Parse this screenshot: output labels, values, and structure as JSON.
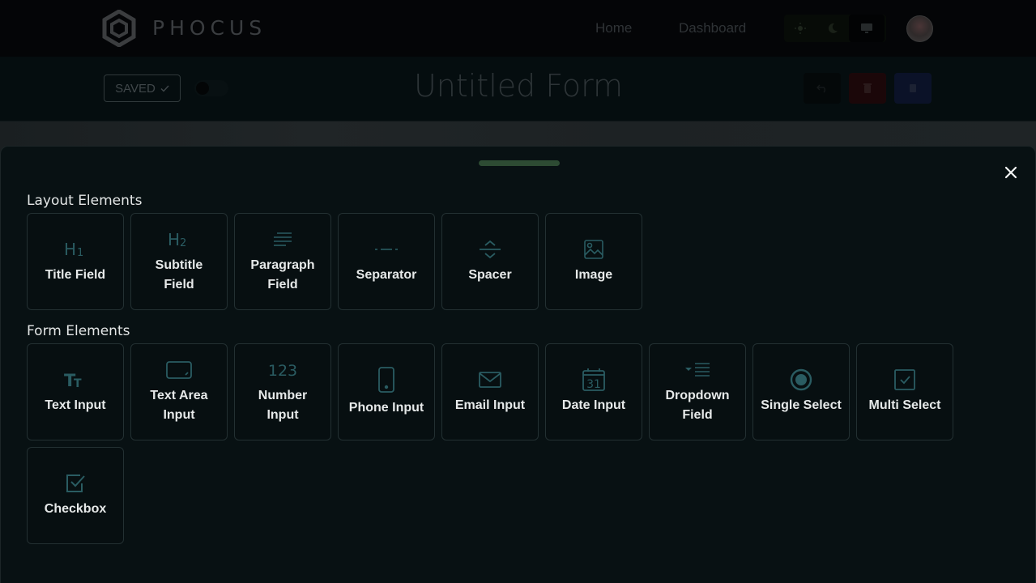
{
  "nav": {
    "brand": "PHOCUS",
    "links": [
      "Home",
      "Dashboard"
    ],
    "theme_options": [
      "light",
      "dark",
      "system"
    ],
    "theme_active": "system"
  },
  "form": {
    "saved_label": "SAVED",
    "title": "Untitled Form"
  },
  "drawer": {
    "sections": [
      {
        "title": "Layout Elements",
        "items": [
          {
            "label": "Title Field",
            "icon": "h1-icon"
          },
          {
            "label": "Subtitle Field",
            "icon": "h2-icon"
          },
          {
            "label": "Paragraph Field",
            "icon": "paragraph-icon"
          },
          {
            "label": "Separator",
            "icon": "separator-icon"
          },
          {
            "label": "Spacer",
            "icon": "spacer-icon"
          },
          {
            "label": "Image",
            "icon": "image-icon"
          }
        ]
      },
      {
        "title": "Form Elements",
        "items": [
          {
            "label": "Text Input",
            "icon": "text-icon"
          },
          {
            "label": "Text Area Input",
            "icon": "textarea-icon"
          },
          {
            "label": "Number Input",
            "icon": "number-icon"
          },
          {
            "label": "Phone Input",
            "icon": "phone-icon"
          },
          {
            "label": "Email Input",
            "icon": "email-icon"
          },
          {
            "label": "Date Input",
            "icon": "calendar-icon"
          },
          {
            "label": "Dropdown Field",
            "icon": "dropdown-icon"
          },
          {
            "label": "Single Select",
            "icon": "radio-icon"
          },
          {
            "label": "Multi Select",
            "icon": "multi-check-icon"
          },
          {
            "label": "Checkbox",
            "icon": "checkbox-icon"
          }
        ]
      }
    ],
    "icon_number_text": "123",
    "icon_date_text": "31"
  },
  "colors": {
    "accent_icon": "#2a5c62",
    "handle": "#2d4b33",
    "drawer_bg": "#081113"
  }
}
